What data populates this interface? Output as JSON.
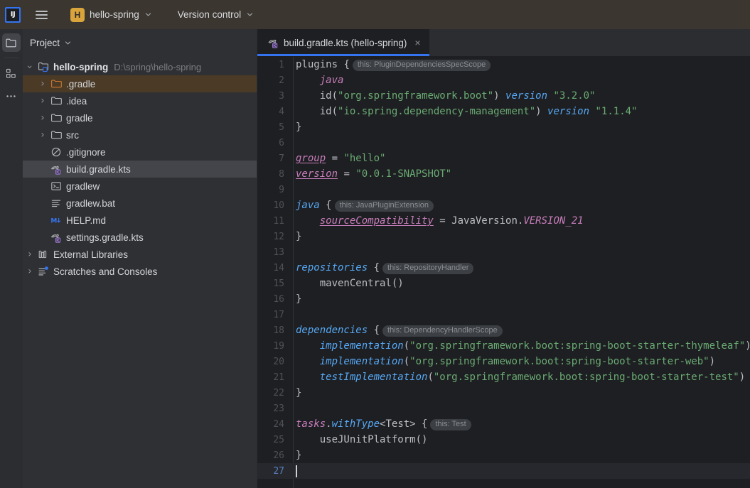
{
  "titlebar": {
    "logo_text": "IJ",
    "logo_name": "intellij-idea-logo",
    "menu_label": "Main Menu",
    "project_badge": "H",
    "project_name": "hello-spring",
    "vcs_label": "Version control"
  },
  "activity_bar": {
    "items": [
      {
        "name": "project-tool-window",
        "icon": "folder-icon",
        "selected": true
      },
      {
        "name": "structure-tool-window",
        "icon": "structure-icon",
        "selected": false
      },
      {
        "name": "more-tool-windows",
        "icon": "more-ellipsis-icon",
        "selected": false
      }
    ]
  },
  "project_panel": {
    "title": "Project",
    "root": {
      "label": "hello-spring",
      "path": "D:\\spring\\hello-spring",
      "icon": "module-folder-icon",
      "expanded": true
    },
    "items": [
      {
        "label": ".gradle",
        "icon": "folder-excluded-icon",
        "twisty": "collapsed",
        "indent": 2,
        "state": "hover"
      },
      {
        "label": ".idea",
        "icon": "folder-icon",
        "twisty": "collapsed",
        "indent": 2,
        "state": ""
      },
      {
        "label": "gradle",
        "icon": "folder-icon",
        "twisty": "collapsed",
        "indent": 2,
        "state": ""
      },
      {
        "label": "src",
        "icon": "folder-icon",
        "twisty": "collapsed",
        "indent": 2,
        "state": ""
      },
      {
        "label": ".gitignore",
        "icon": "gitignore-icon",
        "twisty": "none",
        "indent": 2,
        "state": ""
      },
      {
        "label": "build.gradle.kts",
        "icon": "gradle-kts-icon",
        "twisty": "none",
        "indent": 2,
        "state": "selected"
      },
      {
        "label": "gradlew",
        "icon": "shell-script-icon",
        "twisty": "none",
        "indent": 2,
        "state": ""
      },
      {
        "label": "gradlew.bat",
        "icon": "text-file-icon",
        "twisty": "none",
        "indent": 2,
        "state": ""
      },
      {
        "label": "HELP.md",
        "icon": "markdown-icon",
        "twisty": "none",
        "indent": 2,
        "state": ""
      },
      {
        "label": "settings.gradle.kts",
        "icon": "gradle-kts-icon",
        "twisty": "none",
        "indent": 2,
        "state": ""
      },
      {
        "label": "External Libraries",
        "icon": "library-icon",
        "twisty": "collapsed",
        "indent": 1,
        "state": ""
      },
      {
        "label": "Scratches and Consoles",
        "icon": "scratches-icon",
        "twisty": "collapsed",
        "indent": 1,
        "state": ""
      }
    ]
  },
  "editor": {
    "tab": {
      "label": "build.gradle.kts (hello-spring)",
      "icon": "gradle-kts-icon",
      "close_label": "×",
      "active": true,
      "accent_color": "#3574f0"
    },
    "current_line": 27,
    "lines": [
      {
        "n": 1,
        "tokens": [
          {
            "t": "plugins ",
            "c": "white"
          },
          {
            "t": "{",
            "c": "brace"
          },
          {
            "t": "this: PluginDependenciesSpecScope",
            "c": "hint"
          }
        ]
      },
      {
        "n": 2,
        "tokens": [
          {
            "t": "    ",
            "c": "white"
          },
          {
            "t": "java",
            "c": "plugin"
          }
        ]
      },
      {
        "n": 3,
        "tokens": [
          {
            "t": "    id(",
            "c": "white"
          },
          {
            "t": "\"org.springframework.boot\"",
            "c": "str"
          },
          {
            "t": ") ",
            "c": "white"
          },
          {
            "t": "version",
            "c": "kw"
          },
          {
            "t": " ",
            "c": "white"
          },
          {
            "t": "\"3.2.0\"",
            "c": "str"
          }
        ]
      },
      {
        "n": 4,
        "tokens": [
          {
            "t": "    id(",
            "c": "white"
          },
          {
            "t": "\"io.spring.dependency-management\"",
            "c": "str"
          },
          {
            "t": ") ",
            "c": "white"
          },
          {
            "t": "version",
            "c": "kw"
          },
          {
            "t": " ",
            "c": "white"
          },
          {
            "t": "\"1.1.4\"",
            "c": "str"
          }
        ]
      },
      {
        "n": 5,
        "tokens": [
          {
            "t": "}",
            "c": "brace"
          }
        ]
      },
      {
        "n": 6,
        "tokens": []
      },
      {
        "n": 7,
        "tokens": [
          {
            "t": "group",
            "c": "prop"
          },
          {
            "t": " = ",
            "c": "white"
          },
          {
            "t": "\"hello\"",
            "c": "str"
          }
        ]
      },
      {
        "n": 8,
        "tokens": [
          {
            "t": "version",
            "c": "prop"
          },
          {
            "t": " = ",
            "c": "white"
          },
          {
            "t": "\"0.0.1-SNAPSHOT\"",
            "c": "str"
          }
        ]
      },
      {
        "n": 9,
        "tokens": []
      },
      {
        "n": 10,
        "tokens": [
          {
            "t": "java",
            "c": "fn"
          },
          {
            "t": " ",
            "c": "white"
          },
          {
            "t": "{",
            "c": "brace"
          },
          {
            "t": "this: JavaPluginExtension",
            "c": "hint"
          }
        ]
      },
      {
        "n": 11,
        "tokens": [
          {
            "t": "    ",
            "c": "white"
          },
          {
            "t": "sourceCompatibility",
            "c": "prop"
          },
          {
            "t": " = JavaVersion.",
            "c": "white"
          },
          {
            "t": "VERSION_21",
            "c": "const"
          }
        ]
      },
      {
        "n": 12,
        "tokens": [
          {
            "t": "}",
            "c": "brace"
          }
        ]
      },
      {
        "n": 13,
        "tokens": []
      },
      {
        "n": 14,
        "tokens": [
          {
            "t": "repositories",
            "c": "fn"
          },
          {
            "t": " ",
            "c": "white"
          },
          {
            "t": "{",
            "c": "brace"
          },
          {
            "t": "this: RepositoryHandler",
            "c": "hint"
          }
        ]
      },
      {
        "n": 15,
        "tokens": [
          {
            "t": "    mavenCentral()",
            "c": "white"
          }
        ]
      },
      {
        "n": 16,
        "tokens": [
          {
            "t": "}",
            "c": "brace"
          }
        ]
      },
      {
        "n": 17,
        "tokens": []
      },
      {
        "n": 18,
        "tokens": [
          {
            "t": "dependencies",
            "c": "fn"
          },
          {
            "t": " ",
            "c": "white"
          },
          {
            "t": "{",
            "c": "brace"
          },
          {
            "t": "this: DependencyHandlerScope",
            "c": "hint"
          }
        ]
      },
      {
        "n": 19,
        "tokens": [
          {
            "t": "    ",
            "c": "white"
          },
          {
            "t": "implementation",
            "c": "fn"
          },
          {
            "t": "(",
            "c": "white"
          },
          {
            "t": "\"org.springframework.boot:spring-boot-starter-thymeleaf\"",
            "c": "str"
          },
          {
            "t": ")",
            "c": "white"
          }
        ]
      },
      {
        "n": 20,
        "tokens": [
          {
            "t": "    ",
            "c": "white"
          },
          {
            "t": "implementation",
            "c": "fn"
          },
          {
            "t": "(",
            "c": "white"
          },
          {
            "t": "\"org.springframework.boot:spring-boot-starter-web\"",
            "c": "str"
          },
          {
            "t": ")",
            "c": "white"
          }
        ]
      },
      {
        "n": 21,
        "tokens": [
          {
            "t": "    ",
            "c": "white"
          },
          {
            "t": "testImplementation",
            "c": "fn"
          },
          {
            "t": "(",
            "c": "white"
          },
          {
            "t": "\"org.springframework.boot:spring-boot-starter-test\"",
            "c": "str"
          },
          {
            "t": ")",
            "c": "white"
          }
        ]
      },
      {
        "n": 22,
        "tokens": [
          {
            "t": "}",
            "c": "brace"
          }
        ]
      },
      {
        "n": 23,
        "tokens": []
      },
      {
        "n": 24,
        "tokens": [
          {
            "t": "tasks",
            "c": "const"
          },
          {
            "t": ".",
            "c": "white"
          },
          {
            "t": "withType",
            "c": "fn"
          },
          {
            "t": "<Test> ",
            "c": "white"
          },
          {
            "t": "{",
            "c": "brace"
          },
          {
            "t": "this: Test",
            "c": "hint"
          }
        ]
      },
      {
        "n": 25,
        "tokens": [
          {
            "t": "    useJUnitPlatform()",
            "c": "white"
          }
        ]
      },
      {
        "n": 26,
        "tokens": [
          {
            "t": "}",
            "c": "brace"
          }
        ]
      },
      {
        "n": 27,
        "tokens": [
          {
            "t": "",
            "c": "caret"
          }
        ]
      }
    ]
  }
}
